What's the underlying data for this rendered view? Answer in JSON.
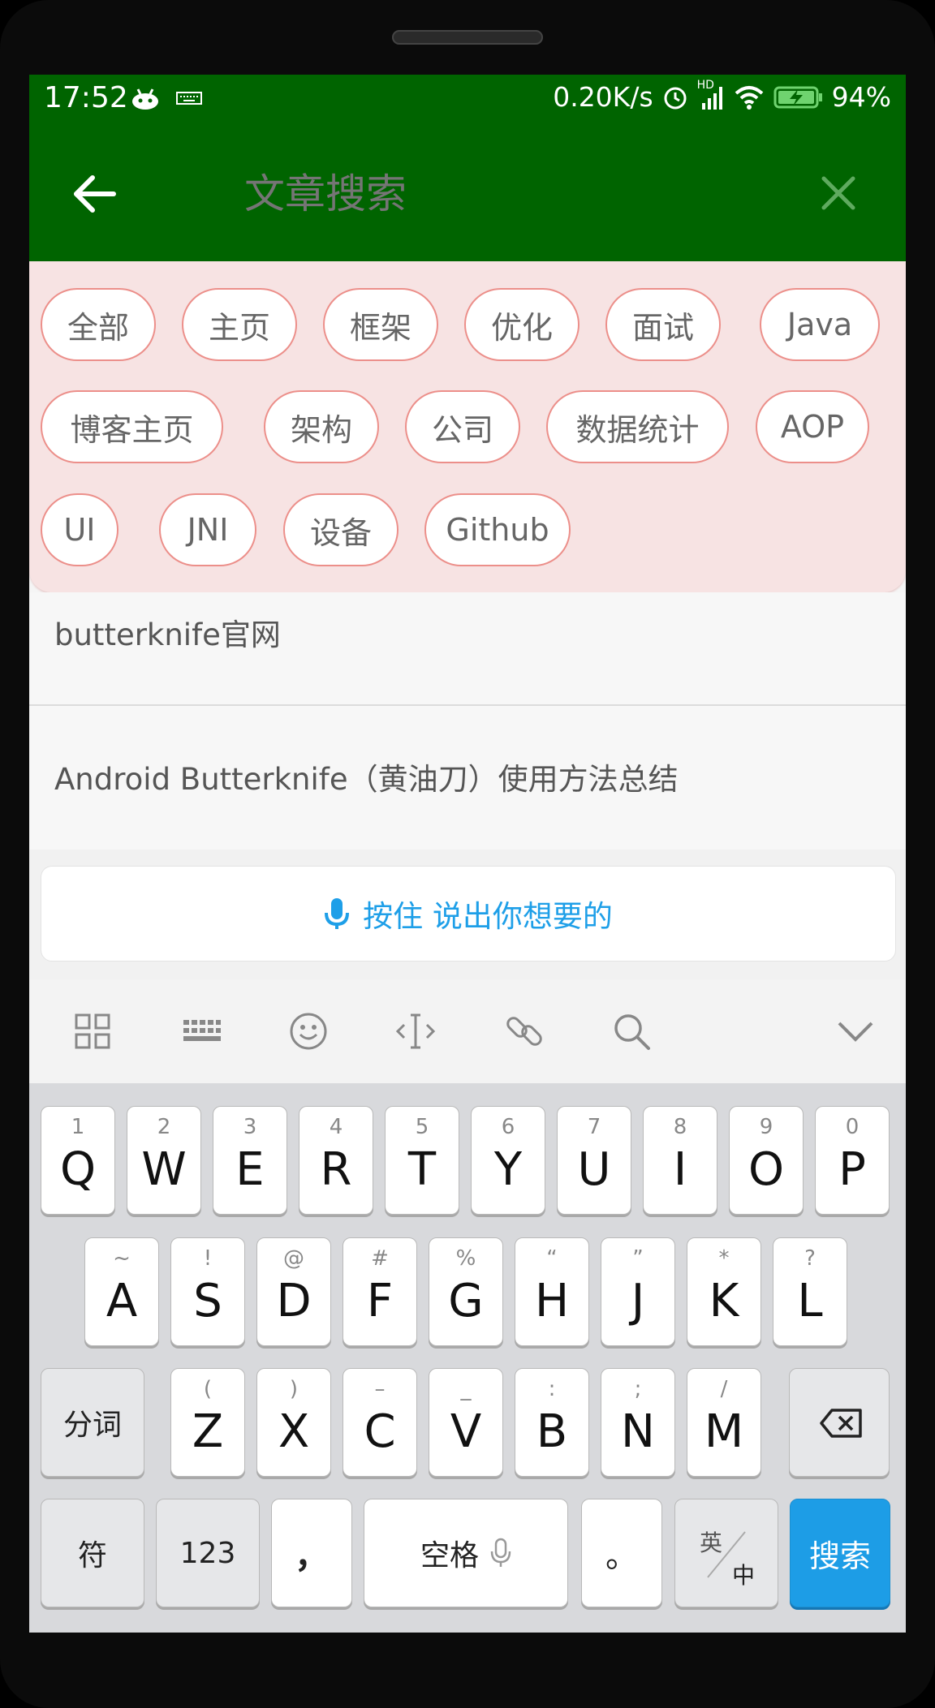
{
  "status_bar": {
    "time": "17:52",
    "network_speed": "0.20K/s",
    "signal_label": "HD",
    "battery_percent": "94%",
    "icons": [
      "android-icon",
      "keyboard-icon",
      "alarm-icon",
      "signal-icon",
      "wifi-icon",
      "battery-charging-icon"
    ]
  },
  "app_bar": {
    "search_placeholder": "文章搜索",
    "back_icon": "arrow-left-icon",
    "clear_icon": "close-icon",
    "background_color": "#006400"
  },
  "tags": [
    "全部",
    "主页",
    "框架",
    "优化",
    "面试",
    "Java",
    "博客主页",
    "架构",
    "公司",
    "数据统计",
    "AOP",
    "UI",
    "JNI",
    "设备",
    "Github"
  ],
  "results": [
    {
      "title": "butterknife官网"
    },
    {
      "title": "Android Butterknife（黄油刀）使用方法总结"
    }
  ],
  "ime": {
    "voice_label": "按住 说出你想要的",
    "toolbar_icons": [
      "grid-icon",
      "keyboard-icon",
      "emoji-icon",
      "cursor-icon",
      "link-icon",
      "search-icon",
      "chevron-down-icon"
    ],
    "row1": [
      {
        "letter": "Q",
        "hint": "1"
      },
      {
        "letter": "W",
        "hint": "2"
      },
      {
        "letter": "E",
        "hint": "3"
      },
      {
        "letter": "R",
        "hint": "4"
      },
      {
        "letter": "T",
        "hint": "5"
      },
      {
        "letter": "Y",
        "hint": "6"
      },
      {
        "letter": "U",
        "hint": "7"
      },
      {
        "letter": "I",
        "hint": "8"
      },
      {
        "letter": "O",
        "hint": "9"
      },
      {
        "letter": "P",
        "hint": "0"
      }
    ],
    "row2": [
      {
        "letter": "A",
        "hint": "~"
      },
      {
        "letter": "S",
        "hint": "!"
      },
      {
        "letter": "D",
        "hint": "@"
      },
      {
        "letter": "F",
        "hint": "#"
      },
      {
        "letter": "G",
        "hint": "%"
      },
      {
        "letter": "H",
        "hint": "“"
      },
      {
        "letter": "J",
        "hint": "”"
      },
      {
        "letter": "K",
        "hint": "*"
      },
      {
        "letter": "L",
        "hint": "?"
      }
    ],
    "row3": [
      {
        "letter": "Z",
        "hint": "("
      },
      {
        "letter": "X",
        "hint": ")"
      },
      {
        "letter": "C",
        "hint": "–"
      },
      {
        "letter": "V",
        "hint": "_"
      },
      {
        "letter": "B",
        "hint": ":"
      },
      {
        "letter": "N",
        "hint": ";"
      },
      {
        "letter": "M",
        "hint": "/"
      }
    ],
    "segment_key": "分词",
    "symbol_key": "符",
    "number_key": "123",
    "comma_key": "，",
    "space_key": "空格",
    "period_key": "。",
    "lang_key_top": "英",
    "lang_key_bottom": "中",
    "search_key": "搜索",
    "accent_color": "#1d9de6"
  }
}
